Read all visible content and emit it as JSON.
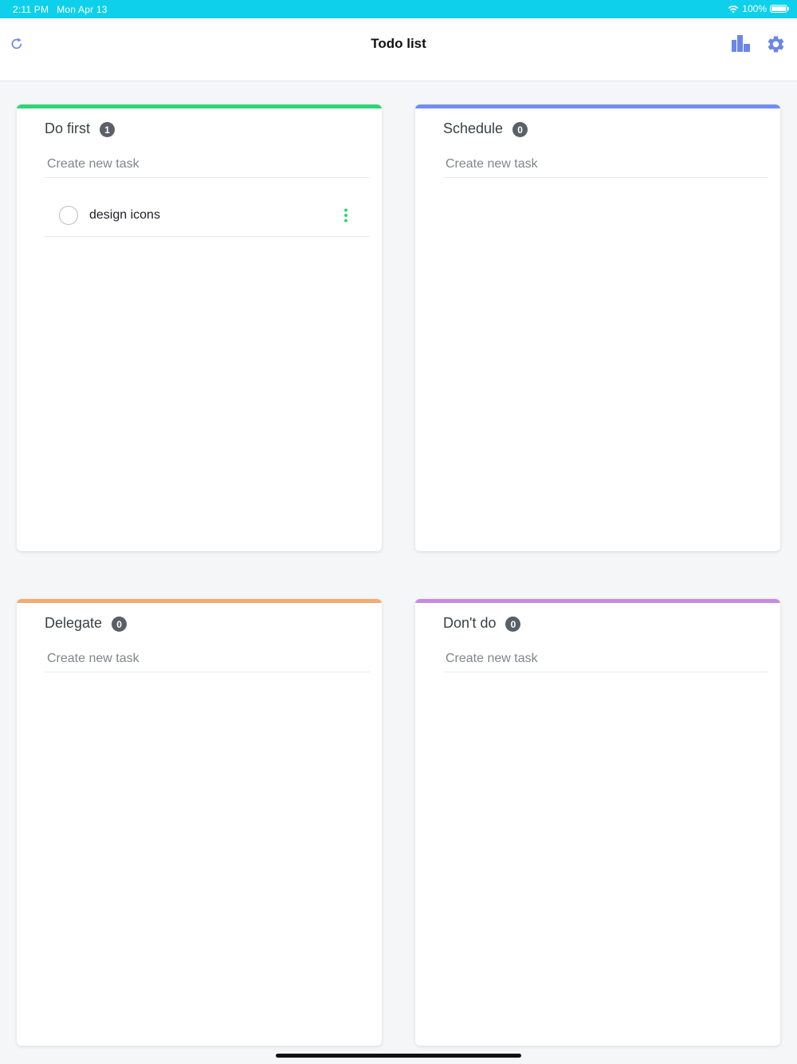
{
  "status_bar": {
    "time": "2:11 PM",
    "date": "Mon Apr 13",
    "battery": "100%",
    "battery_level": 1.0
  },
  "navbar": {
    "title": "Todo list",
    "left_icon": "refresh-icon",
    "right_icons": [
      "bar-chart-icon",
      "gear-icon"
    ],
    "accent_color": "#6b86e8"
  },
  "quadrants": [
    {
      "label": "Do first",
      "count": "1",
      "color": "#2ed573",
      "input_placeholder": "Create new task",
      "tasks": [
        {
          "text": "design icons",
          "done": false
        }
      ]
    },
    {
      "label": "Schedule",
      "count": "0",
      "color": "#6f8ef0",
      "input_placeholder": "Create new task",
      "tasks": []
    },
    {
      "label": "Delegate",
      "count": "0",
      "color": "#f0ad6e",
      "input_placeholder": "Create new task",
      "tasks": []
    },
    {
      "label": "Don't do",
      "count": "0",
      "color": "#c58be0",
      "input_placeholder": "Create new task",
      "tasks": []
    }
  ]
}
